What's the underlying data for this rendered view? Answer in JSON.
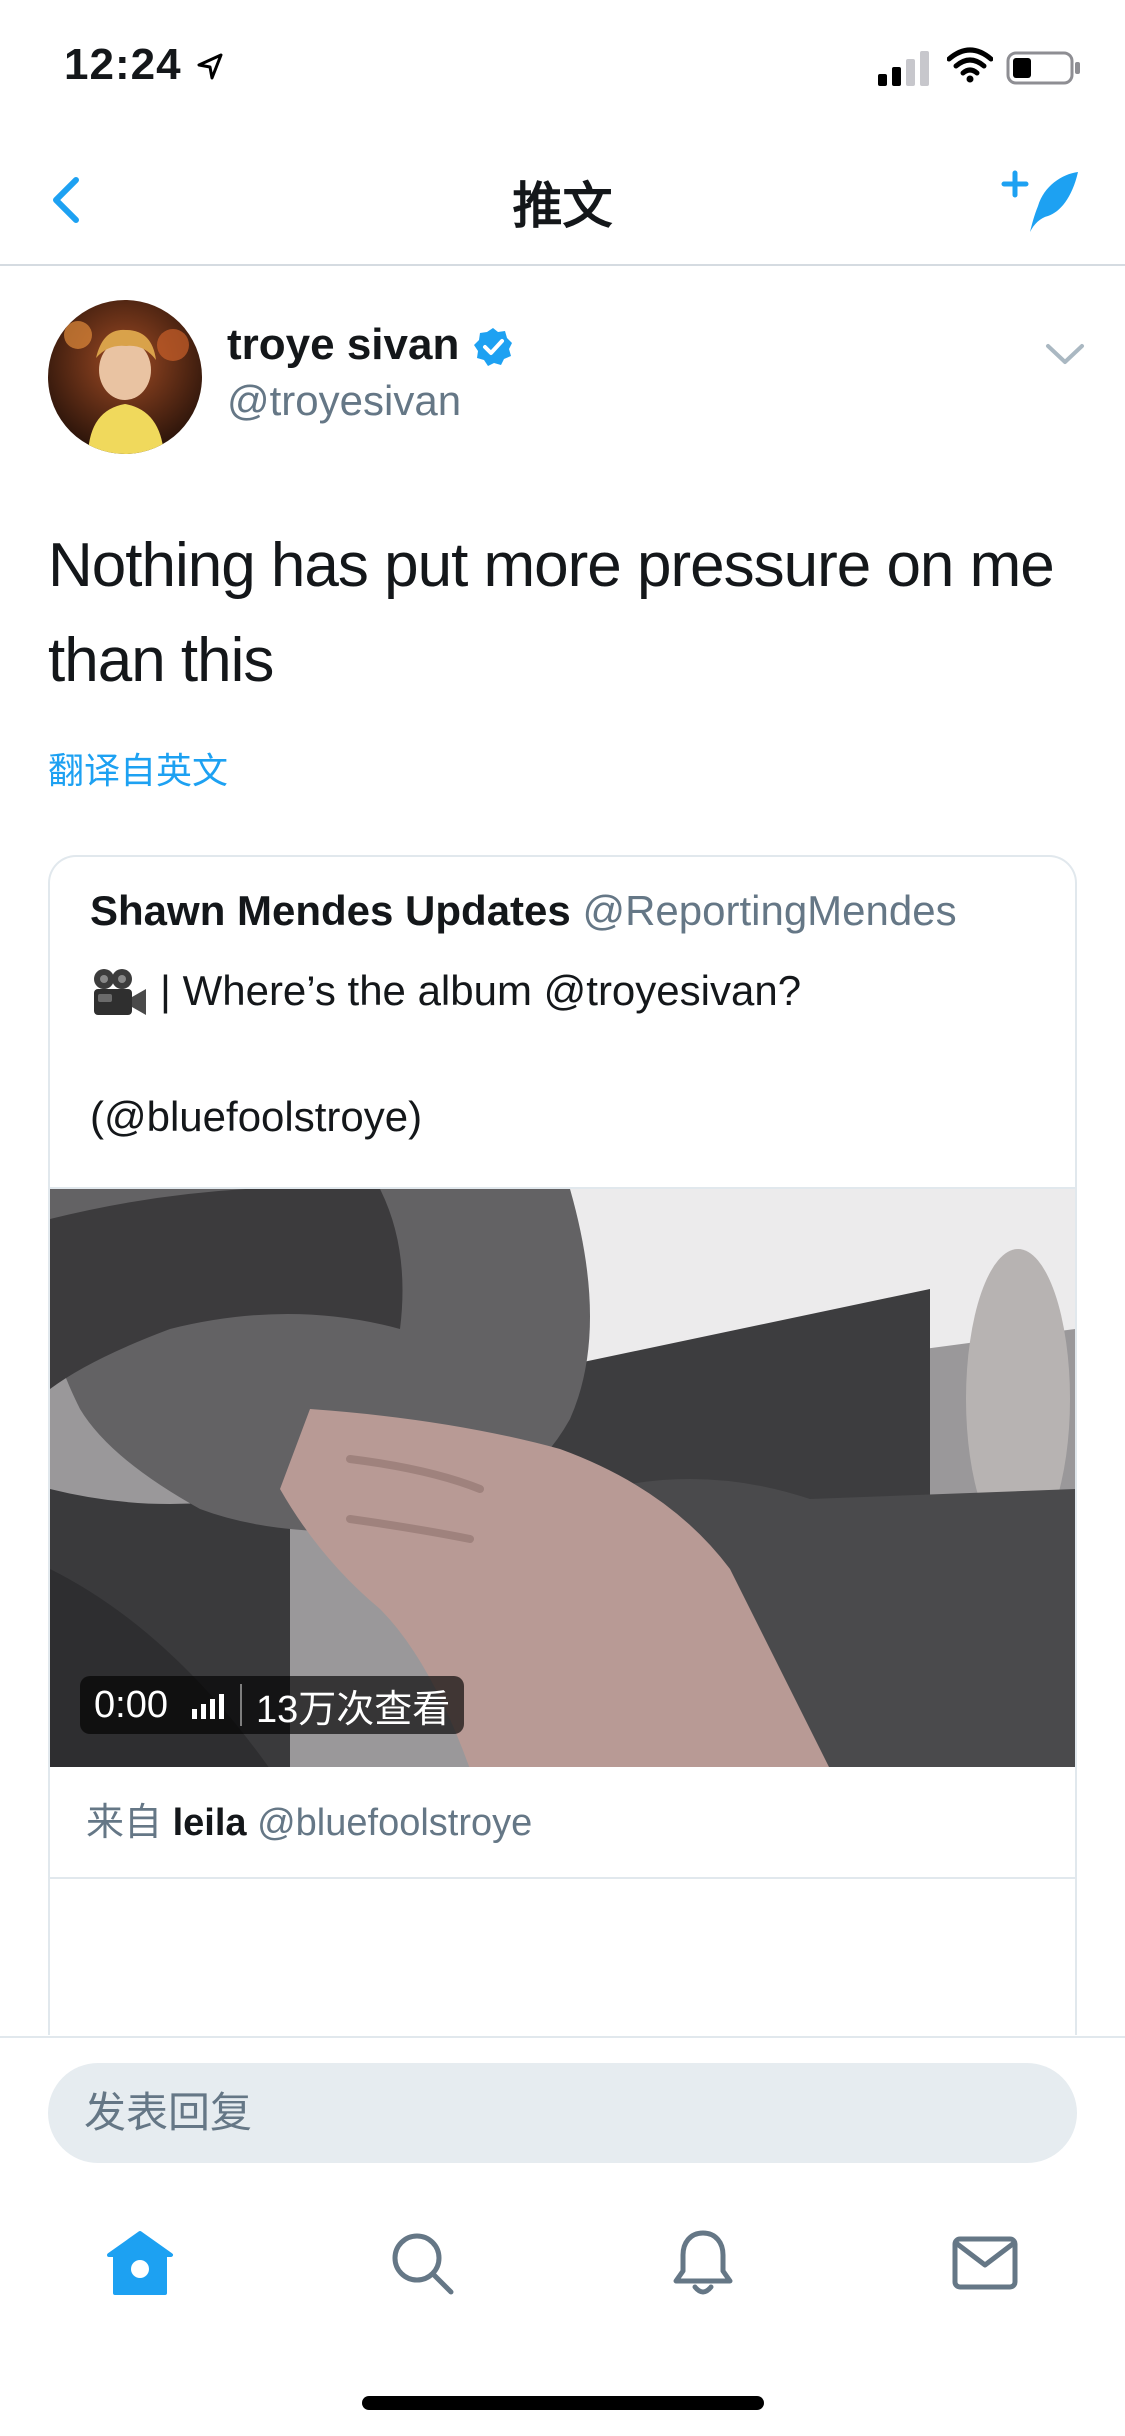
{
  "status_bar": {
    "time": "12:24",
    "icons": [
      "location-arrow-icon",
      "signal-icon",
      "wifi-icon",
      "battery-icon"
    ]
  },
  "nav": {
    "title": "推文",
    "back_icon": "chevron-left-icon",
    "compose_icon": "compose-feather-icon"
  },
  "tweet": {
    "author_name": "troye sivan",
    "author_handle": "@troyesivan",
    "verified": true,
    "text": "Nothing has put more pressure on me than this",
    "translate_label": "翻译自英文"
  },
  "quote": {
    "name": "Shawn Mendes Updates",
    "handle": "@ReportingMendes",
    "line1": "| Where’s the album @troyesivan?",
    "line2": "(@bluefoolstroye)",
    "camera_icon": "movie-camera-icon",
    "video": {
      "time": "0:00",
      "views": "13万次查看"
    },
    "attribution": {
      "prefix": "来自",
      "name": "leila",
      "handle": "@bluefoolstroye"
    }
  },
  "reply": {
    "placeholder": "发表回复"
  },
  "tabs": [
    {
      "icon": "home-icon",
      "active": true
    },
    {
      "icon": "search-icon",
      "active": false
    },
    {
      "icon": "notifications-bell-icon",
      "active": false
    },
    {
      "icon": "messages-envelope-icon",
      "active": false
    }
  ],
  "colors": {
    "accent": "#1da1f2",
    "secondary_text": "#657786",
    "border": "#e1e8ed"
  }
}
